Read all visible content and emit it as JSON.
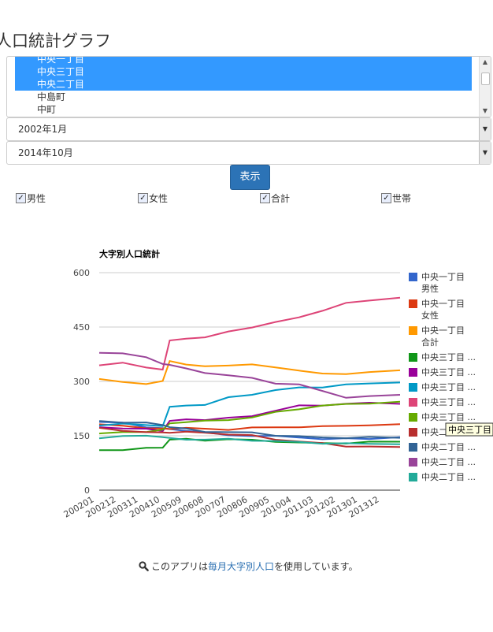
{
  "page": {
    "title": "人口統計グラフ"
  },
  "area_list": {
    "items": [
      {
        "label": "中央一丁目",
        "selected": true
      },
      {
        "label": "中央三丁目",
        "selected": true
      },
      {
        "label": "中央二丁目",
        "selected": true
      },
      {
        "label": "中島町",
        "selected": false
      },
      {
        "label": "中町",
        "selected": false
      }
    ]
  },
  "start_select": {
    "value": "2002年1月"
  },
  "end_select": {
    "value": "2014年10月"
  },
  "display_button": {
    "label": "表示"
  },
  "checkboxes": [
    {
      "label": "男性",
      "checked": true
    },
    {
      "label": "女性",
      "checked": true
    },
    {
      "label": "合計",
      "checked": true
    },
    {
      "label": "世帯",
      "checked": true
    }
  ],
  "footer": {
    "prefix": "このアプリは",
    "link": "毎月大字別人口",
    "suffix": "を使用しています。"
  },
  "chart_data": {
    "type": "line",
    "title": "大字別人口統計",
    "ylim": [
      0,
      600
    ],
    "yticks": [
      "0",
      "150",
      "300",
      "450",
      "600"
    ],
    "xticks": [
      "200201",
      "200212",
      "200311",
      "200410",
      "200509",
      "200608",
      "200707",
      "200806",
      "200905",
      "201004",
      "201103",
      "201202",
      "201301",
      "201312"
    ],
    "grid": true,
    "legend": "right",
    "tooltip": "中央三丁目",
    "x": [
      2002.0,
      2003.0,
      2004.0,
      2004.7,
      2005.0,
      2005.7,
      2006.5,
      2007.5,
      2008.5,
      2009.5,
      2010.5,
      2011.5,
      2012.5,
      2013.5,
      2014.8
    ],
    "series": [
      {
        "name": "中央一丁目 男性",
        "legend": [
          "中央一丁目",
          "男性"
        ],
        "color": "#3366cc",
        "values": [
          188,
          185,
          175,
          170,
          168,
          165,
          158,
          152,
          150,
          148,
          147,
          140,
          142,
          143,
          145
        ]
      },
      {
        "name": "中央一丁目 女性",
        "legend": [
          "中央一丁目",
          "女性"
        ],
        "color": "#dc3912",
        "values": [
          180,
          178,
          172,
          168,
          170,
          172,
          168,
          168,
          172,
          173,
          175,
          175,
          178,
          180,
          180
        ]
      },
      {
        "name": "中央一丁目 合計",
        "legend": [
          "中央一丁目",
          "合計"
        ],
        "color": "#ff9900",
        "values": [
          305,
          300,
          292,
          300,
          358,
          345,
          342,
          345,
          345,
          340,
          330,
          320,
          322,
          325,
          330
        ]
      },
      {
        "name": "中央三丁目 ...",
        "legend": [
          "中央三丁目 ..."
        ],
        "color": "#109618",
        "values": [
          110,
          112,
          115,
          118,
          140,
          140,
          138,
          140,
          138,
          135,
          130,
          130,
          130,
          132,
          135
        ]
      },
      {
        "name": "中央三丁目 ...",
        "legend": [
          "中央三丁目 ..."
        ],
        "color": "#990099",
        "values": [
          175,
          170,
          168,
          165,
          190,
          195,
          195,
          198,
          205,
          220,
          232,
          235,
          238,
          240,
          240
        ]
      },
      {
        "name": "中央三丁目 ...",
        "legend": [
          "中央三丁目 ..."
        ],
        "color": "#0099c6",
        "values": [
          180,
          182,
          180,
          178,
          228,
          235,
          235,
          255,
          265,
          275,
          283,
          285,
          290,
          295,
          298
        ]
      },
      {
        "name": "中央三丁目 ...",
        "legend": [
          "中央三丁目 ..."
        ],
        "color": "#dd4477",
        "values": [
          345,
          350,
          340,
          332,
          412,
          420,
          420,
          438,
          450,
          462,
          478,
          495,
          515,
          525,
          530
        ]
      },
      {
        "name": "中央三丁目 ...",
        "legend": [
          "中央三丁目 ..."
        ],
        "color": "#66aa00",
        "values": [
          155,
          160,
          162,
          165,
          185,
          188,
          190,
          195,
          200,
          215,
          225,
          232,
          238,
          240,
          242
        ]
      },
      {
        "name": "中央二丁目 ...",
        "legend": [
          "中央二丁目 ..."
        ],
        "color": "#b82e2e",
        "values": [
          170,
          165,
          160,
          158,
          160,
          160,
          158,
          155,
          150,
          140,
          135,
          128,
          122,
          120,
          118
        ]
      },
      {
        "name": "中央二丁目 ...",
        "legend": [
          "中央二丁目 ..."
        ],
        "color": "#316395",
        "values": [
          190,
          188,
          185,
          180,
          175,
          168,
          162,
          160,
          158,
          152,
          148,
          145,
          145,
          145,
          145
        ]
      },
      {
        "name": "中央二丁目 ...",
        "legend": [
          "中央二丁目 ..."
        ],
        "color": "#994499",
        "values": [
          380,
          378,
          365,
          350,
          345,
          335,
          325,
          315,
          310,
          295,
          290,
          275,
          255,
          258,
          265
        ]
      },
      {
        "name": "中央二丁目 ...",
        "legend": [
          "中央二丁目 ..."
        ],
        "color": "#22aa99",
        "values": [
          145,
          148,
          150,
          148,
          142,
          140,
          140,
          140,
          138,
          135,
          132,
          130,
          128,
          128,
          128
        ]
      }
    ]
  }
}
